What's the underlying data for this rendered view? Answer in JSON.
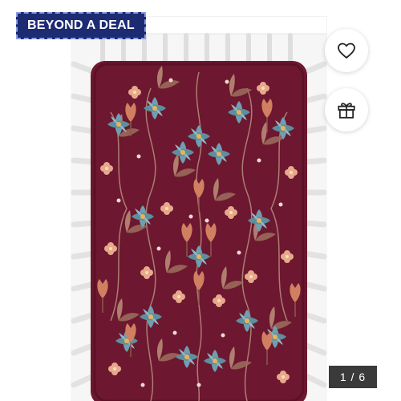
{
  "badge": {
    "label": "BEYOND A DEAL"
  },
  "actions": {
    "favorite_icon": "heart-icon",
    "gift_icon": "gift-icon"
  },
  "gallery": {
    "counter": "1 / 6"
  },
  "colors": {
    "badge_bg": "#1d2b73",
    "sheet": "#6d1730",
    "counter_bg": "#3a3a3a"
  }
}
